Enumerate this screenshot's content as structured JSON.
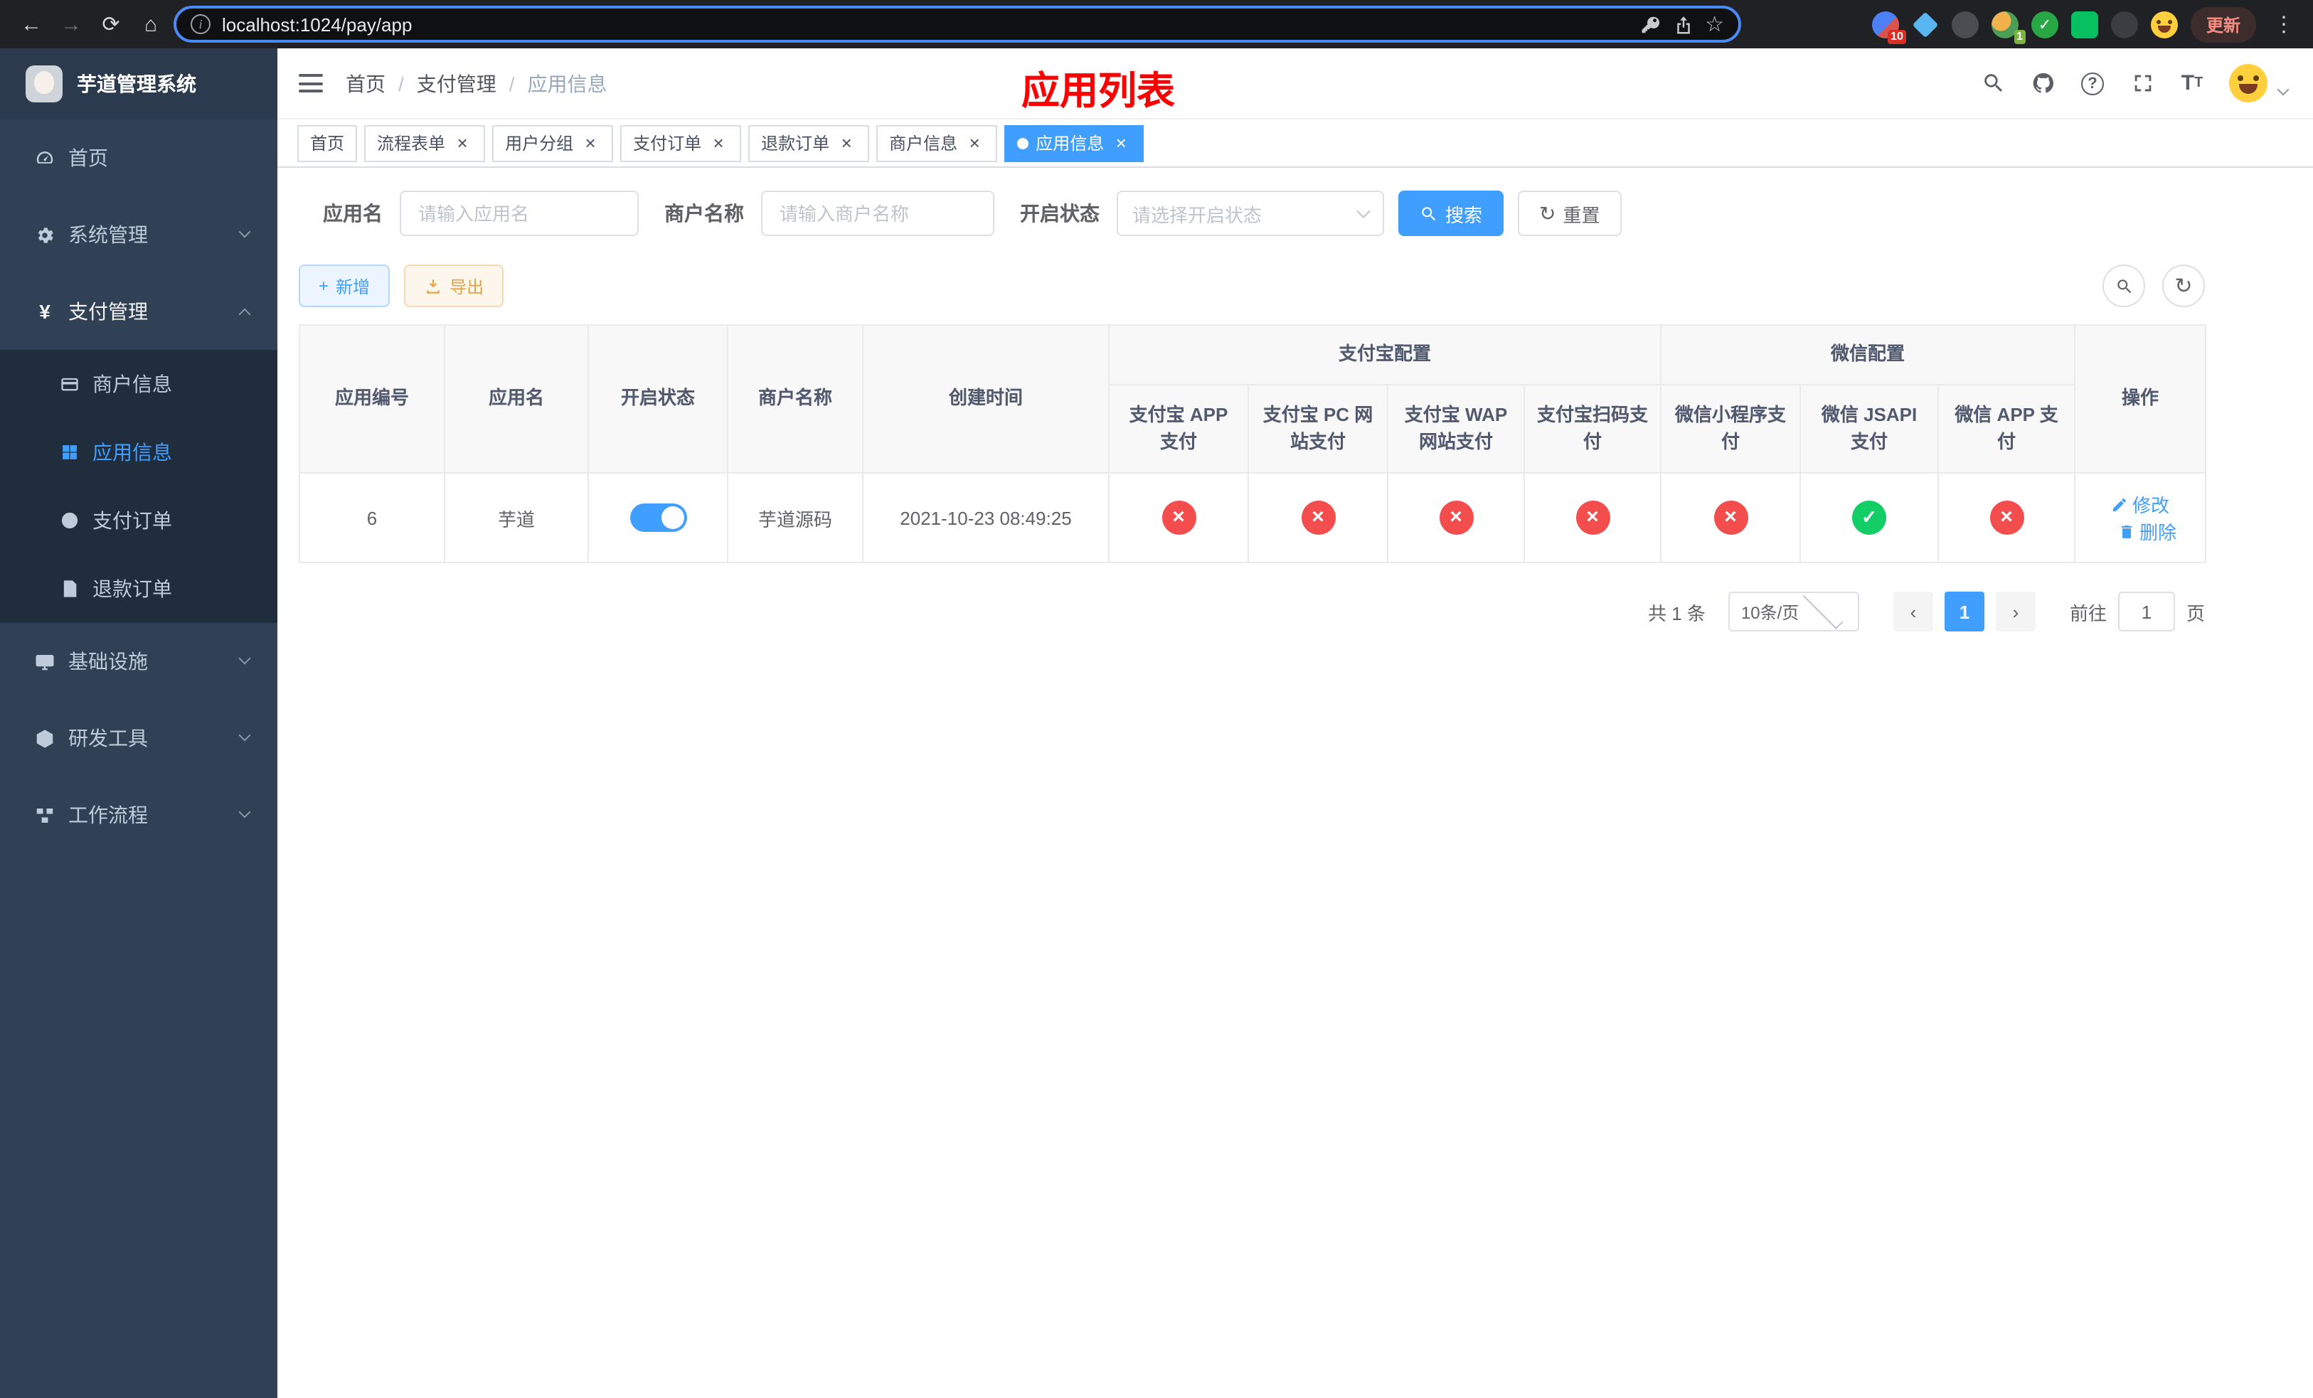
{
  "browser": {
    "url": "localhost:1024/pay/app",
    "update_label": "更新",
    "extensions_badge": "10",
    "profile_badge": "1"
  },
  "sidebar": {
    "logo_title": "芋道管理系统",
    "menu": [
      {
        "label": "首页"
      },
      {
        "label": "系统管理"
      },
      {
        "label": "支付管理",
        "children": [
          {
            "label": "商户信息"
          },
          {
            "label": "应用信息"
          },
          {
            "label": "支付订单"
          },
          {
            "label": "退款订单"
          }
        ]
      },
      {
        "label": "基础设施"
      },
      {
        "label": "研发工具"
      },
      {
        "label": "工作流程"
      }
    ]
  },
  "header": {
    "breadcrumb": [
      "首页",
      "支付管理",
      "应用信息"
    ],
    "separator": "/",
    "title": "应用列表"
  },
  "tabs": [
    {
      "label": "首页"
    },
    {
      "label": "流程表单"
    },
    {
      "label": "用户分组"
    },
    {
      "label": "支付订单"
    },
    {
      "label": "退款订单"
    },
    {
      "label": "商户信息"
    },
    {
      "label": "应用信息"
    }
  ],
  "filters": {
    "app_name": {
      "label": "应用名",
      "placeholder": "请输入应用名"
    },
    "merchant_name": {
      "label": "商户名称",
      "placeholder": "请输入商户名称"
    },
    "status": {
      "label": "开启状态",
      "placeholder": "请选择开启状态"
    },
    "search_label": "搜索",
    "reset_label": "重置"
  },
  "toolbar": {
    "add_label": "新增",
    "export_label": "导出"
  },
  "table": {
    "groups": {
      "alipay": "支付宝配置",
      "wechat": "微信配置"
    },
    "columns": {
      "app_id": "应用编号",
      "app_name": "应用名",
      "status": "开启状态",
      "merchant_name": "商户名称",
      "create_time": "创建时间",
      "alipay_app": "支付宝 APP 支付",
      "alipay_pc": "支付宝 PC 网站支付",
      "alipay_wap": "支付宝 WAP 网站支付",
      "alipay_qr": "支付宝扫码支付",
      "wechat_mini": "微信小程序支付",
      "wechat_jsapi": "微信 JSAPI 支付",
      "wechat_app": "微信 APP 支付",
      "actions": "操作"
    },
    "rows": [
      {
        "app_id": "6",
        "app_name": "芋道",
        "status": "on",
        "merchant_name": "芋道源码",
        "create_time": "2021-10-23 08:49:25",
        "alipay_app": "fail",
        "alipay_pc": "fail",
        "alipay_wap": "fail",
        "alipay_qr": "fail",
        "wechat_mini": "fail",
        "wechat_jsapi": "success",
        "wechat_app": "fail",
        "edit_label": "修改",
        "delete_label": "删除"
      }
    ]
  },
  "pagination": {
    "total": "共 1 条",
    "page_size": "10条/页",
    "page": "1",
    "goto_label": "前往",
    "goto_value": "1",
    "page_unit": "页"
  },
  "colors": {
    "primary": "#409eff",
    "success": "#13ce66",
    "danger": "#f34d4d",
    "warning": "#e6a23c",
    "title_red": "#ff0000",
    "sidebar_bg": "#304156",
    "submenu_bg": "#1f2d3d"
  }
}
